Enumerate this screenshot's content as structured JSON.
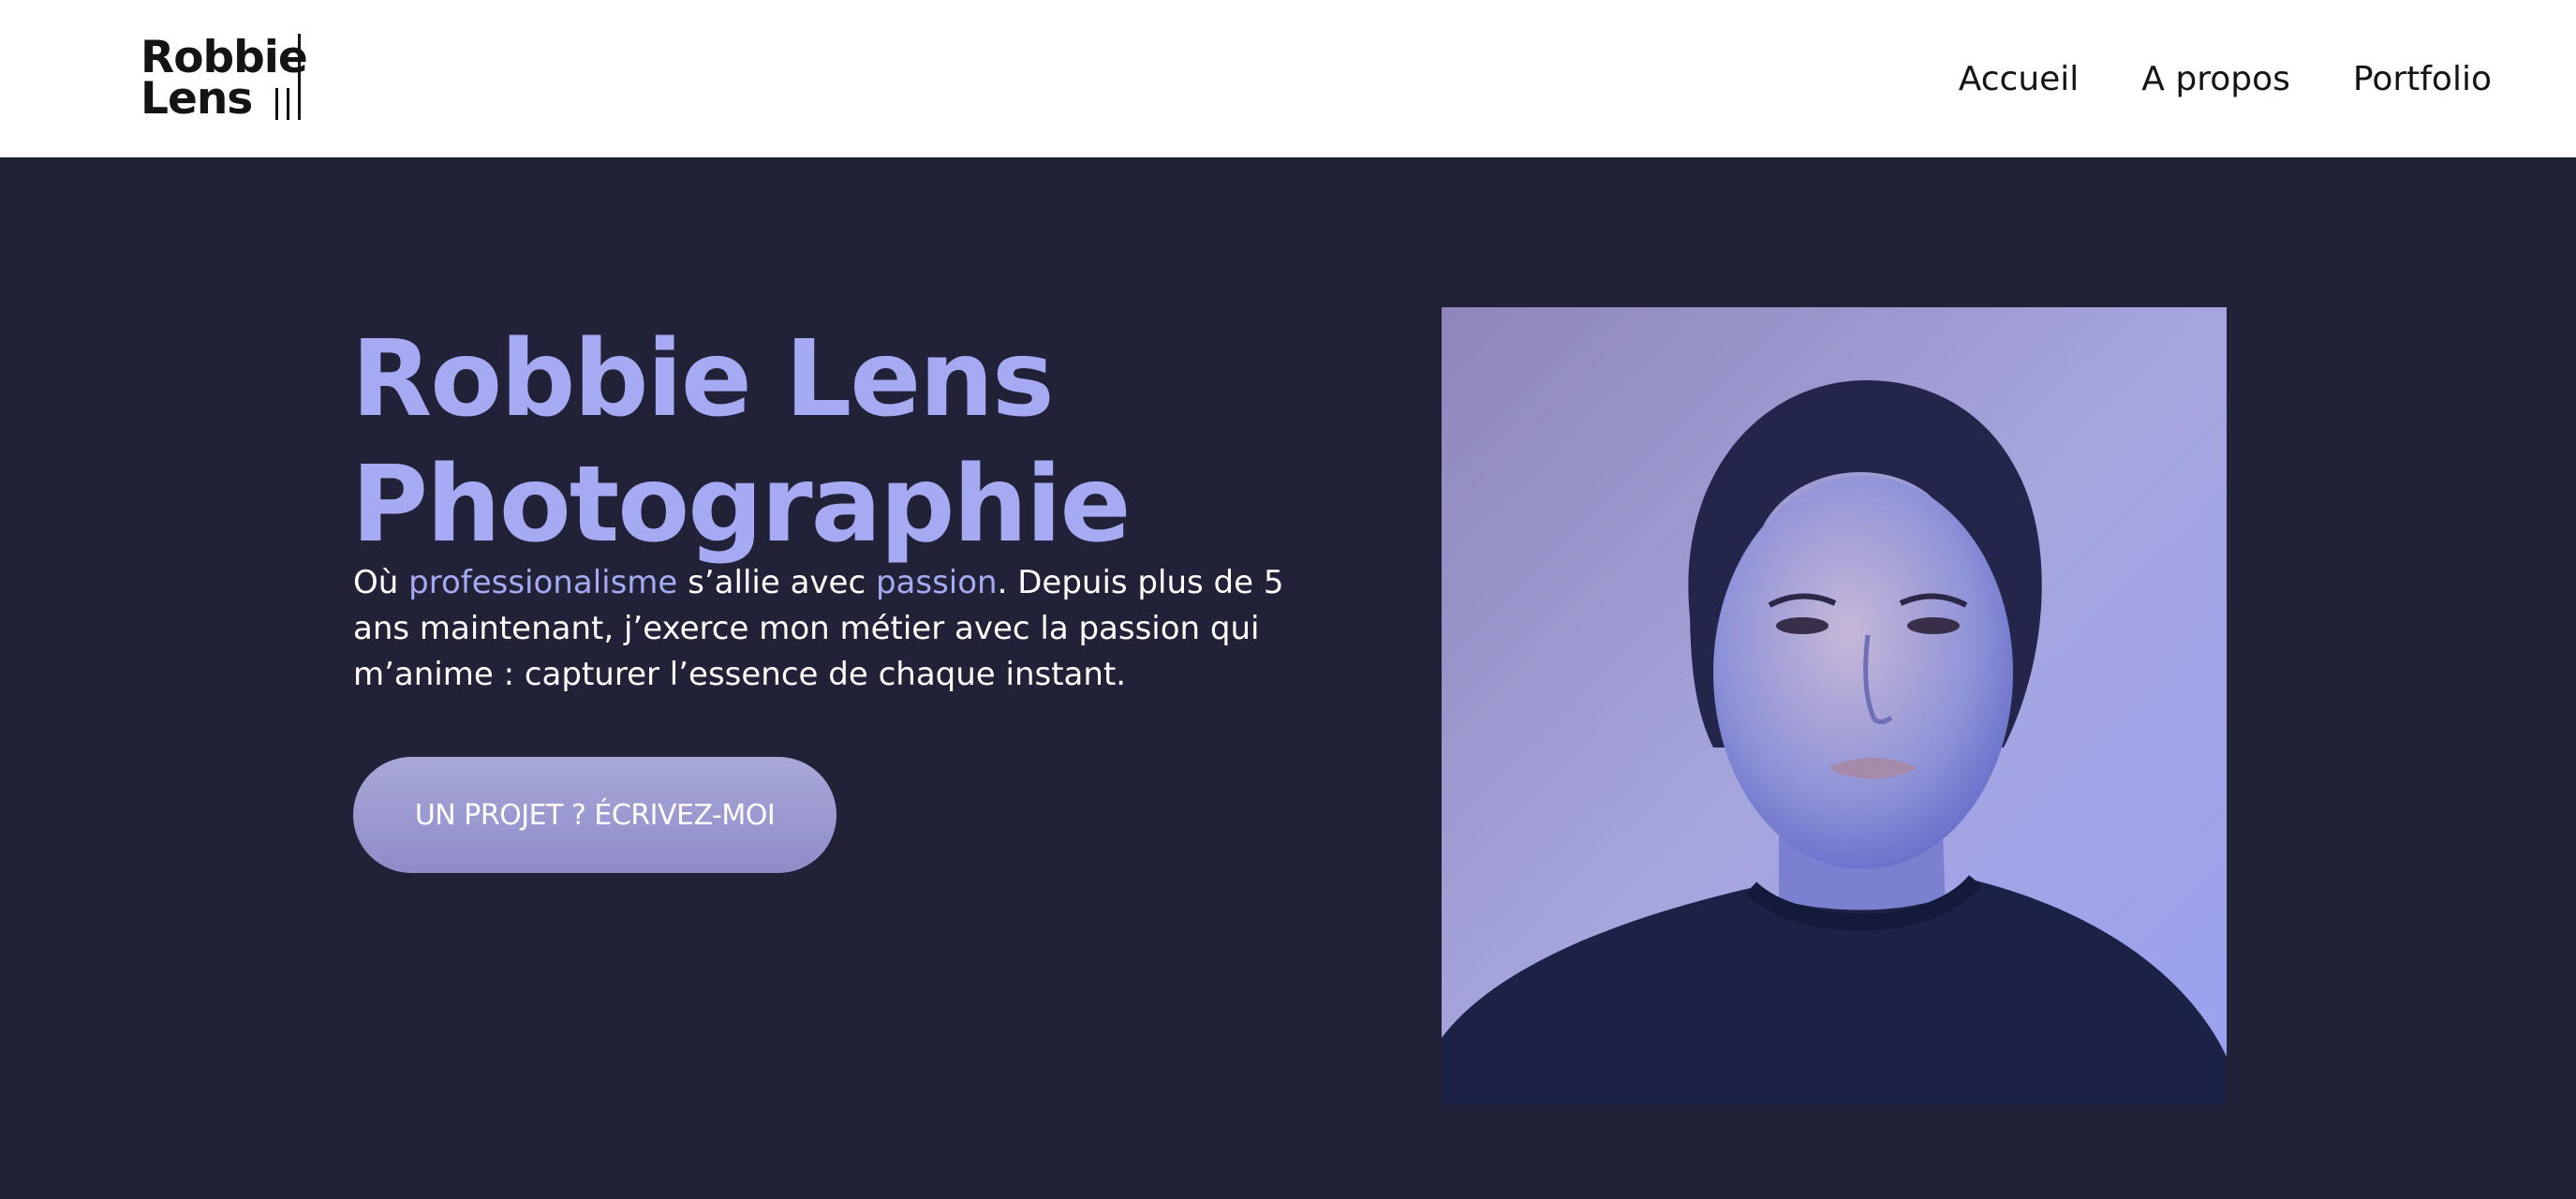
{
  "header": {
    "logo_line1": "Robbie",
    "logo_line2": "Lens",
    "nav": [
      "Accueil",
      "A propos",
      "Portfolio"
    ]
  },
  "hero": {
    "title_line1": "Robbie Lens",
    "title_line2": "Photographie",
    "desc_part1": "Où ",
    "desc_accent1": "professionalisme",
    "desc_part2": " s’allie avec ",
    "desc_accent2": "passion",
    "desc_part3": ". Depuis plus de 5 ans maintenant, j’exerce mon métier avec la passion qui m’anime : capturer l’essence de chaque instant.",
    "cta_label": "UN PROJET ? ÉCRIVEZ-MOI"
  },
  "colors": {
    "hero_bg": "#212137",
    "accent": "#a5aaf2",
    "header_bg": "#ffffff",
    "cta_bg": "#9d9bd2"
  },
  "icons": [
    "logo-bars-icon"
  ]
}
